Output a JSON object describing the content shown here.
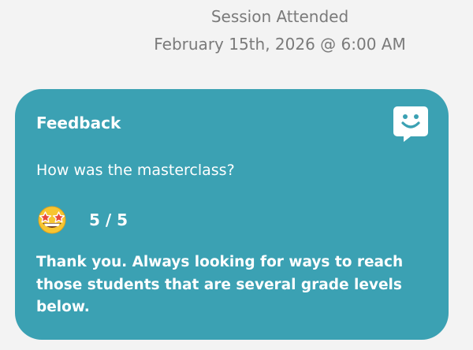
{
  "session": {
    "title": "Session Attended",
    "datetime": "February 15th, 2026 @ 6:00 AM"
  },
  "feedback": {
    "heading": "Feedback",
    "question": "How was the masterclass?",
    "rating": {
      "emoji_icon": "star-struck-emoji-icon",
      "score": 5,
      "max": 5,
      "display": "5 / 5"
    },
    "comment": "Thank you.  Always looking for ways to reach those students that are several grade levels below.",
    "icon": "smiley-chat-bubble-icon"
  },
  "colors": {
    "page_background": "#f3f3f3",
    "card_background": "#3ba1b3",
    "header_text": "#7a7a7a",
    "card_text": "#ffffff"
  }
}
